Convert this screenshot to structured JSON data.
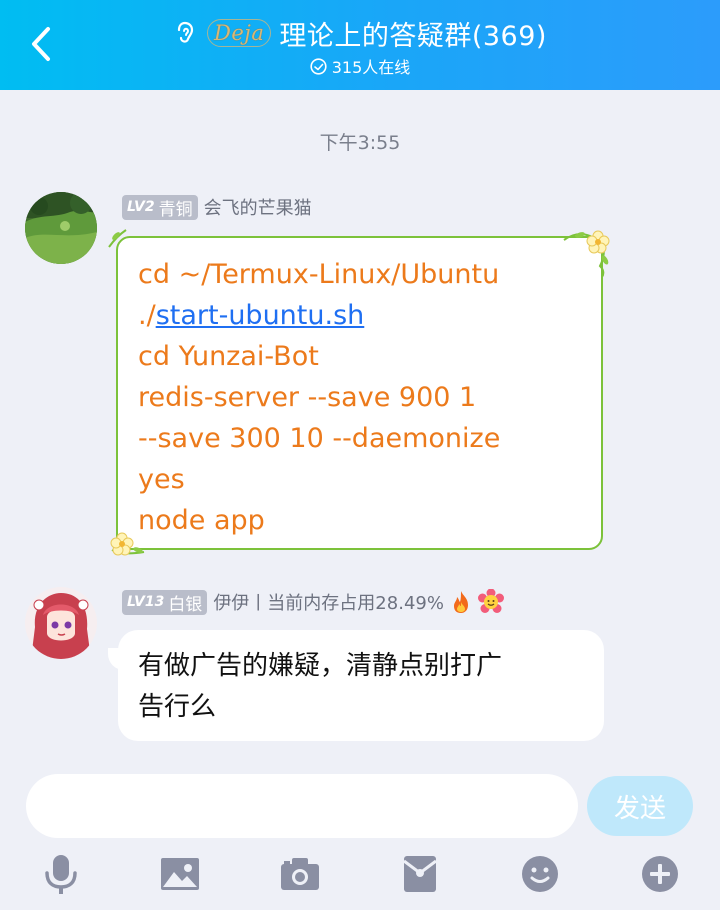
{
  "header": {
    "title": "理论上的答疑群(369)",
    "badge_text": "Deja",
    "online_text": "315人在线",
    "colors": {
      "gradient_start": "#00bdf2",
      "gradient_end": "#2c9cfb"
    }
  },
  "chat": {
    "timestamp": "下午3:55",
    "messages": [
      {
        "level": "LV2",
        "level_name": "青铜",
        "sender": "会飞的芒果猫",
        "lines": [
          "cd ~/Termux-Linux/Ubuntu",
          "./",
          "start-ubuntu.sh",
          "cd Yunzai-Bot",
          "redis-server --save 900 1",
          "--save 300 10 --daemonize",
          "yes",
          "node app"
        ]
      },
      {
        "level": "LV13",
        "level_name": "白银",
        "sender": "伊伊丨当前内存占用28.49%",
        "lines": [
          "有做广告的嫌疑，清静点别打广",
          "告行么"
        ]
      }
    ]
  },
  "composer": {
    "input_value": "",
    "send_label": "发送"
  },
  "toolbar": [
    "mic-icon",
    "image-icon",
    "camera-icon",
    "red-packet-icon",
    "emoji-icon",
    "plus-icon"
  ]
}
